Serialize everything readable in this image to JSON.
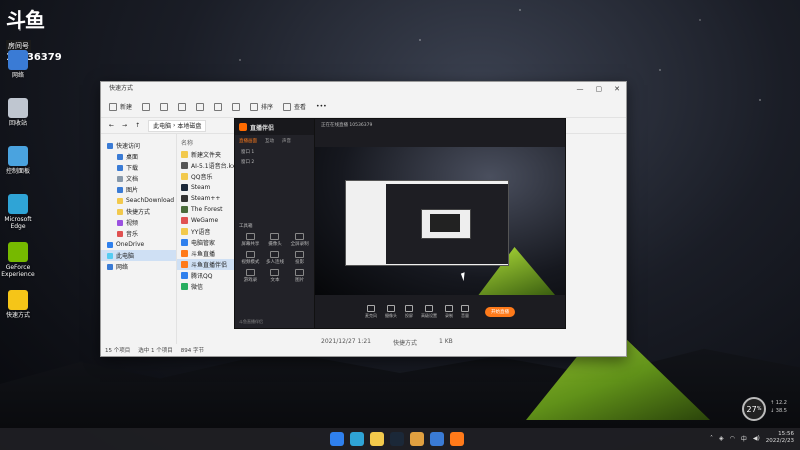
{
  "watermark": {
    "logo": "斗鱼",
    "room_label": "房间号",
    "room_number": "10536379"
  },
  "desktop": {
    "icons": [
      {
        "label": "网络",
        "icon": "network-icon",
        "color": "#3a7bd5"
      },
      {
        "label": "回收站",
        "icon": "recycle-bin-icon",
        "color": "#bfc6d0"
      },
      {
        "label": "控制面板",
        "icon": "control-panel-icon",
        "color": "#4aa3df"
      },
      {
        "label": "Microsoft Edge",
        "icon": "edge-icon",
        "color": "#2fa4d6"
      },
      {
        "label": "GeForce Experience",
        "icon": "geforce-icon",
        "color": "#76b900"
      },
      {
        "label": "快速方式",
        "icon": "star-icon",
        "color": "#f5c518"
      }
    ]
  },
  "explorer": {
    "title": "快速方式",
    "toolbar": {
      "new": "新建",
      "sort": "排序",
      "view": "查看"
    },
    "breadcrumb": [
      "此电脑",
      "本地磁盘"
    ],
    "nav": [
      {
        "label": "快速访问",
        "sub": false,
        "color": "#3a7bd5",
        "selected": false
      },
      {
        "label": "桌面",
        "sub": true,
        "color": "#3a7bd5",
        "selected": false
      },
      {
        "label": "下载",
        "sub": true,
        "color": "#3a7bd5",
        "selected": false
      },
      {
        "label": "文档",
        "sub": true,
        "color": "#8899aa",
        "selected": false
      },
      {
        "label": "图片",
        "sub": true,
        "color": "#3a7bd5",
        "selected": false
      },
      {
        "label": "SeachDownload",
        "sub": true,
        "color": "#f2c94c",
        "selected": false
      },
      {
        "label": "快捷方式",
        "sub": true,
        "color": "#f2c94c",
        "selected": false
      },
      {
        "label": "视频",
        "sub": true,
        "color": "#9b51e0",
        "selected": false
      },
      {
        "label": "音乐",
        "sub": true,
        "color": "#e05151",
        "selected": false
      },
      {
        "label": "OneDrive",
        "sub": false,
        "color": "#2f80ed",
        "selected": false
      },
      {
        "label": "此电脑",
        "sub": false,
        "color": "#56ccf2",
        "selected": true
      },
      {
        "label": "网络",
        "sub": false,
        "color": "#3a7bd5",
        "selected": false
      }
    ],
    "column_name": "名称",
    "files": [
      {
        "name": "新建文件夹",
        "color": "#f2c94c",
        "selected": false
      },
      {
        "name": "AI-5.1语音台.kx",
        "color": "#555555",
        "selected": false
      },
      {
        "name": "QQ音乐",
        "color": "#f2c94c",
        "selected": false
      },
      {
        "name": "Steam",
        "color": "#1b2838",
        "selected": false
      },
      {
        "name": "Steam++",
        "color": "#333333",
        "selected": false
      },
      {
        "name": "The Forest",
        "color": "#4a6b3a",
        "selected": false
      },
      {
        "name": "WeGame",
        "color": "#e05151",
        "selected": false
      },
      {
        "name": "YY语音",
        "color": "#f2c94c",
        "selected": false
      },
      {
        "name": "电脑管家",
        "color": "#2f80ed",
        "selected": false
      },
      {
        "name": "斗鱼直播",
        "color": "#ff7a1a",
        "selected": false
      },
      {
        "name": "斗鱼直播伴侣",
        "color": "#ff7a1a",
        "selected": true
      },
      {
        "name": "腾讯QQ",
        "color": "#2f80ed",
        "selected": false
      },
      {
        "name": "微信",
        "color": "#27ae60",
        "selected": false
      }
    ],
    "bottom_row": {
      "date": "2021/12/27 1:21",
      "type": "快捷方式",
      "size": "1 KB"
    },
    "status": {
      "count": "15 个项目",
      "selected": "选中 1 个项目",
      "size": "894 字节"
    }
  },
  "stream_app": {
    "logo": "直播伴侣",
    "tabs": [
      "直播画面",
      "互动",
      "声音"
    ],
    "scenes": [
      "窗口 1",
      "窗口 2"
    ],
    "toolbox_label": "工具箱",
    "tools": [
      "屏幕共享",
      "摄像头",
      "全屏录制",
      "视频模式",
      "多人连线",
      "投影",
      "游戏录",
      "文本",
      "图片"
    ],
    "header_line": "正在在线直播 10536379",
    "bottom_buttons": [
      "麦克风",
      "摄像头",
      "投屏",
      "高级设置",
      "录制",
      "音量"
    ],
    "live_button": "开始直播",
    "footer": "斗鱼直播伴侣"
  },
  "taskbar": {
    "apps": [
      {
        "icon": "windows-start-icon",
        "color": "#2f80ed"
      },
      {
        "icon": "edge-icon",
        "color": "#2fa4d6"
      },
      {
        "icon": "file-explorer-icon",
        "color": "#f2c94c"
      },
      {
        "icon": "steam-icon",
        "color": "#1b2838"
      },
      {
        "icon": "game-icon",
        "color": "#e0a040"
      },
      {
        "icon": "shield-icon",
        "color": "#3a7bd5"
      },
      {
        "icon": "douyu-icon",
        "color": "#ff7a1a"
      }
    ],
    "ime": "中",
    "time": "15:56",
    "date": "2022/2/23"
  },
  "gauge": {
    "value": "27",
    "unit": "%",
    "up": "12.2",
    "down": "38.5"
  }
}
